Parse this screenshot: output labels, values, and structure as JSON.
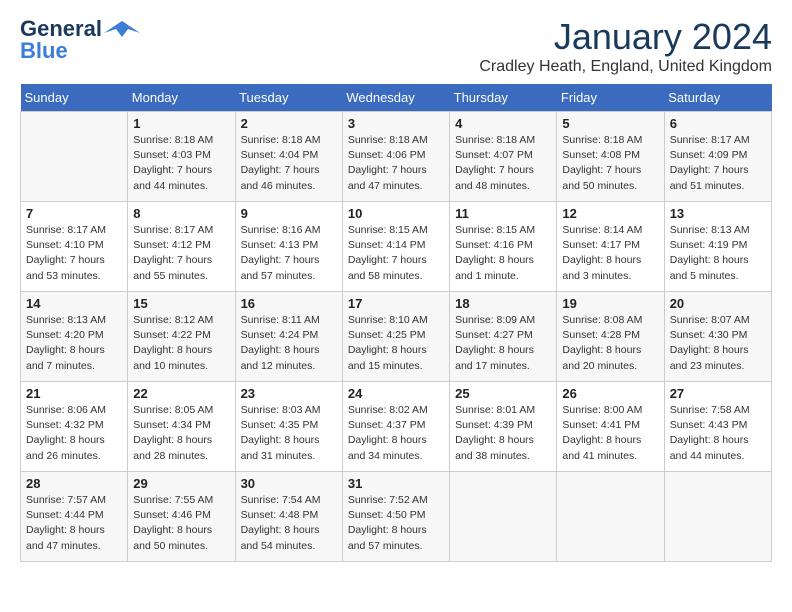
{
  "header": {
    "logo_general": "General",
    "logo_blue": "Blue",
    "month": "January 2024",
    "location": "Cradley Heath, England, United Kingdom"
  },
  "days_of_week": [
    "Sunday",
    "Monday",
    "Tuesday",
    "Wednesday",
    "Thursday",
    "Friday",
    "Saturday"
  ],
  "weeks": [
    [
      {
        "day": "",
        "info": ""
      },
      {
        "day": "1",
        "info": "Sunrise: 8:18 AM\nSunset: 4:03 PM\nDaylight: 7 hours\nand 44 minutes."
      },
      {
        "day": "2",
        "info": "Sunrise: 8:18 AM\nSunset: 4:04 PM\nDaylight: 7 hours\nand 46 minutes."
      },
      {
        "day": "3",
        "info": "Sunrise: 8:18 AM\nSunset: 4:06 PM\nDaylight: 7 hours\nand 47 minutes."
      },
      {
        "day": "4",
        "info": "Sunrise: 8:18 AM\nSunset: 4:07 PM\nDaylight: 7 hours\nand 48 minutes."
      },
      {
        "day": "5",
        "info": "Sunrise: 8:18 AM\nSunset: 4:08 PM\nDaylight: 7 hours\nand 50 minutes."
      },
      {
        "day": "6",
        "info": "Sunrise: 8:17 AM\nSunset: 4:09 PM\nDaylight: 7 hours\nand 51 minutes."
      }
    ],
    [
      {
        "day": "7",
        "info": "Sunrise: 8:17 AM\nSunset: 4:10 PM\nDaylight: 7 hours\nand 53 minutes."
      },
      {
        "day": "8",
        "info": "Sunrise: 8:17 AM\nSunset: 4:12 PM\nDaylight: 7 hours\nand 55 minutes."
      },
      {
        "day": "9",
        "info": "Sunrise: 8:16 AM\nSunset: 4:13 PM\nDaylight: 7 hours\nand 57 minutes."
      },
      {
        "day": "10",
        "info": "Sunrise: 8:15 AM\nSunset: 4:14 PM\nDaylight: 7 hours\nand 58 minutes."
      },
      {
        "day": "11",
        "info": "Sunrise: 8:15 AM\nSunset: 4:16 PM\nDaylight: 8 hours\nand 1 minute."
      },
      {
        "day": "12",
        "info": "Sunrise: 8:14 AM\nSunset: 4:17 PM\nDaylight: 8 hours\nand 3 minutes."
      },
      {
        "day": "13",
        "info": "Sunrise: 8:13 AM\nSunset: 4:19 PM\nDaylight: 8 hours\nand 5 minutes."
      }
    ],
    [
      {
        "day": "14",
        "info": "Sunrise: 8:13 AM\nSunset: 4:20 PM\nDaylight: 8 hours\nand 7 minutes."
      },
      {
        "day": "15",
        "info": "Sunrise: 8:12 AM\nSunset: 4:22 PM\nDaylight: 8 hours\nand 10 minutes."
      },
      {
        "day": "16",
        "info": "Sunrise: 8:11 AM\nSunset: 4:24 PM\nDaylight: 8 hours\nand 12 minutes."
      },
      {
        "day": "17",
        "info": "Sunrise: 8:10 AM\nSunset: 4:25 PM\nDaylight: 8 hours\nand 15 minutes."
      },
      {
        "day": "18",
        "info": "Sunrise: 8:09 AM\nSunset: 4:27 PM\nDaylight: 8 hours\nand 17 minutes."
      },
      {
        "day": "19",
        "info": "Sunrise: 8:08 AM\nSunset: 4:28 PM\nDaylight: 8 hours\nand 20 minutes."
      },
      {
        "day": "20",
        "info": "Sunrise: 8:07 AM\nSunset: 4:30 PM\nDaylight: 8 hours\nand 23 minutes."
      }
    ],
    [
      {
        "day": "21",
        "info": "Sunrise: 8:06 AM\nSunset: 4:32 PM\nDaylight: 8 hours\nand 26 minutes."
      },
      {
        "day": "22",
        "info": "Sunrise: 8:05 AM\nSunset: 4:34 PM\nDaylight: 8 hours\nand 28 minutes."
      },
      {
        "day": "23",
        "info": "Sunrise: 8:03 AM\nSunset: 4:35 PM\nDaylight: 8 hours\nand 31 minutes."
      },
      {
        "day": "24",
        "info": "Sunrise: 8:02 AM\nSunset: 4:37 PM\nDaylight: 8 hours\nand 34 minutes."
      },
      {
        "day": "25",
        "info": "Sunrise: 8:01 AM\nSunset: 4:39 PM\nDaylight: 8 hours\nand 38 minutes."
      },
      {
        "day": "26",
        "info": "Sunrise: 8:00 AM\nSunset: 4:41 PM\nDaylight: 8 hours\nand 41 minutes."
      },
      {
        "day": "27",
        "info": "Sunrise: 7:58 AM\nSunset: 4:43 PM\nDaylight: 8 hours\nand 44 minutes."
      }
    ],
    [
      {
        "day": "28",
        "info": "Sunrise: 7:57 AM\nSunset: 4:44 PM\nDaylight: 8 hours\nand 47 minutes."
      },
      {
        "day": "29",
        "info": "Sunrise: 7:55 AM\nSunset: 4:46 PM\nDaylight: 8 hours\nand 50 minutes."
      },
      {
        "day": "30",
        "info": "Sunrise: 7:54 AM\nSunset: 4:48 PM\nDaylight: 8 hours\nand 54 minutes."
      },
      {
        "day": "31",
        "info": "Sunrise: 7:52 AM\nSunset: 4:50 PM\nDaylight: 8 hours\nand 57 minutes."
      },
      {
        "day": "",
        "info": ""
      },
      {
        "day": "",
        "info": ""
      },
      {
        "day": "",
        "info": ""
      }
    ]
  ]
}
